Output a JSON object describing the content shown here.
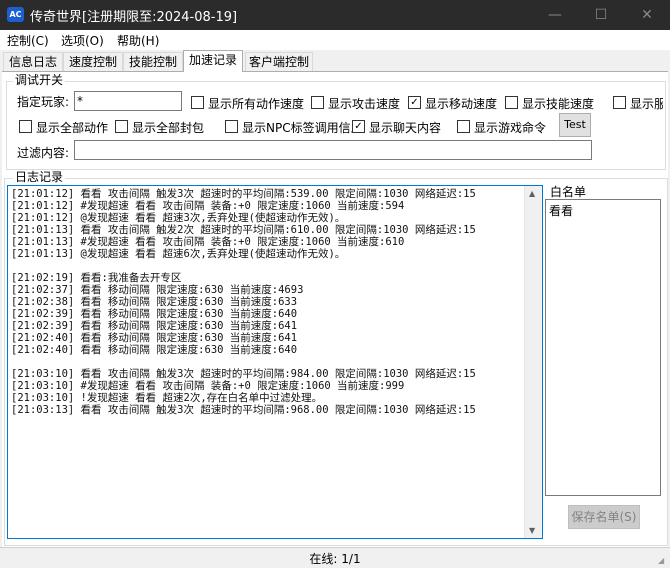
{
  "window": {
    "title": "传奇世界[注册期限至:2024-08-19]",
    "icon_text": "AC",
    "minimize_glyph": "—",
    "maximize_glyph": "☐",
    "close_glyph": "✕"
  },
  "menu": [
    {
      "label": "控制(C)"
    },
    {
      "label": "选项(O)"
    },
    {
      "label": "帮助(H)"
    }
  ],
  "tabs": [
    {
      "label": "信息日志"
    },
    {
      "label": "速度控制"
    },
    {
      "label": "技能控制"
    },
    {
      "label": "加速记录",
      "active": true
    },
    {
      "label": "客户端控制"
    }
  ],
  "debug": {
    "group_title": "调试开关",
    "player_label": "指定玩家:",
    "player_value": "*",
    "checkboxes": [
      {
        "label": "显示所有动作速度",
        "checked": false
      },
      {
        "label": "显示攻击速度",
        "checked": false
      },
      {
        "label": "显示移动速度",
        "checked": true
      },
      {
        "label": "显示技能速度",
        "checked": false
      },
      {
        "label": "显示服",
        "checked": false
      },
      {
        "label": "显示全部动作",
        "checked": false
      },
      {
        "label": "显示全部封包",
        "checked": false
      },
      {
        "label": "显示NPC标签调用信息",
        "checked": false
      },
      {
        "label": "显示聊天内容",
        "checked": true
      },
      {
        "label": "显示游戏命令",
        "checked": false
      }
    ],
    "test_button": "Test",
    "filter_label": "过滤内容:",
    "filter_value": ""
  },
  "log": {
    "group_title": "日志记录",
    "lines": [
      "[21:01:12] 看看 攻击间隔 触发3次 超速时的平均间隔:539.00 限定间隔:1030 网络延迟:15",
      "[21:01:12] #发现超速 看看 攻击间隔 装备:+0 限定速度:1060 当前速度:594",
      "[21:01:12] @发现超速 看看 超速3次,丢弃处理(使超速动作无效)。",
      "[21:01:13] 看看 攻击间隔 触发2次 超速时的平均间隔:610.00 限定间隔:1030 网络延迟:15",
      "[21:01:13] #发现超速 看看 攻击间隔 装备:+0 限定速度:1060 当前速度:610",
      "[21:01:13] @发现超速 看看 超速6次,丢弃处理(使超速动作无效)。",
      "",
      "[21:02:19] 看看:我准备去开专区",
      "[21:02:37] 看看 移动间隔 限定速度:630 当前速度:4693",
      "[21:02:38] 看看 移动间隔 限定速度:630 当前速度:633",
      "[21:02:39] 看看 移动间隔 限定速度:630 当前速度:640",
      "[21:02:39] 看看 移动间隔 限定速度:630 当前速度:641",
      "[21:02:40] 看看 移动间隔 限定速度:630 当前速度:641",
      "[21:02:40] 看看 移动间隔 限定速度:630 当前速度:640",
      "",
      "[21:03:10] 看看 攻击间隔 触发3次 超速时的平均间隔:984.00 限定间隔:1030 网络延迟:15",
      "[21:03:10] #发现超速 看看 攻击间隔 装备:+0 限定速度:1060 当前速度:999",
      "[21:03:10] !发现超速 看看 超速2次,存在白名单中过滤处理。",
      "[21:03:13] 看看 攻击间隔 触发3次 超速时的平均间隔:968.00 限定间隔:1030 网络延迟:15"
    ]
  },
  "whitelist": {
    "title": "白名单",
    "items": [
      "看看"
    ],
    "save_button": "保存名单(S)"
  },
  "status": {
    "online": "在线: 1/1"
  }
}
